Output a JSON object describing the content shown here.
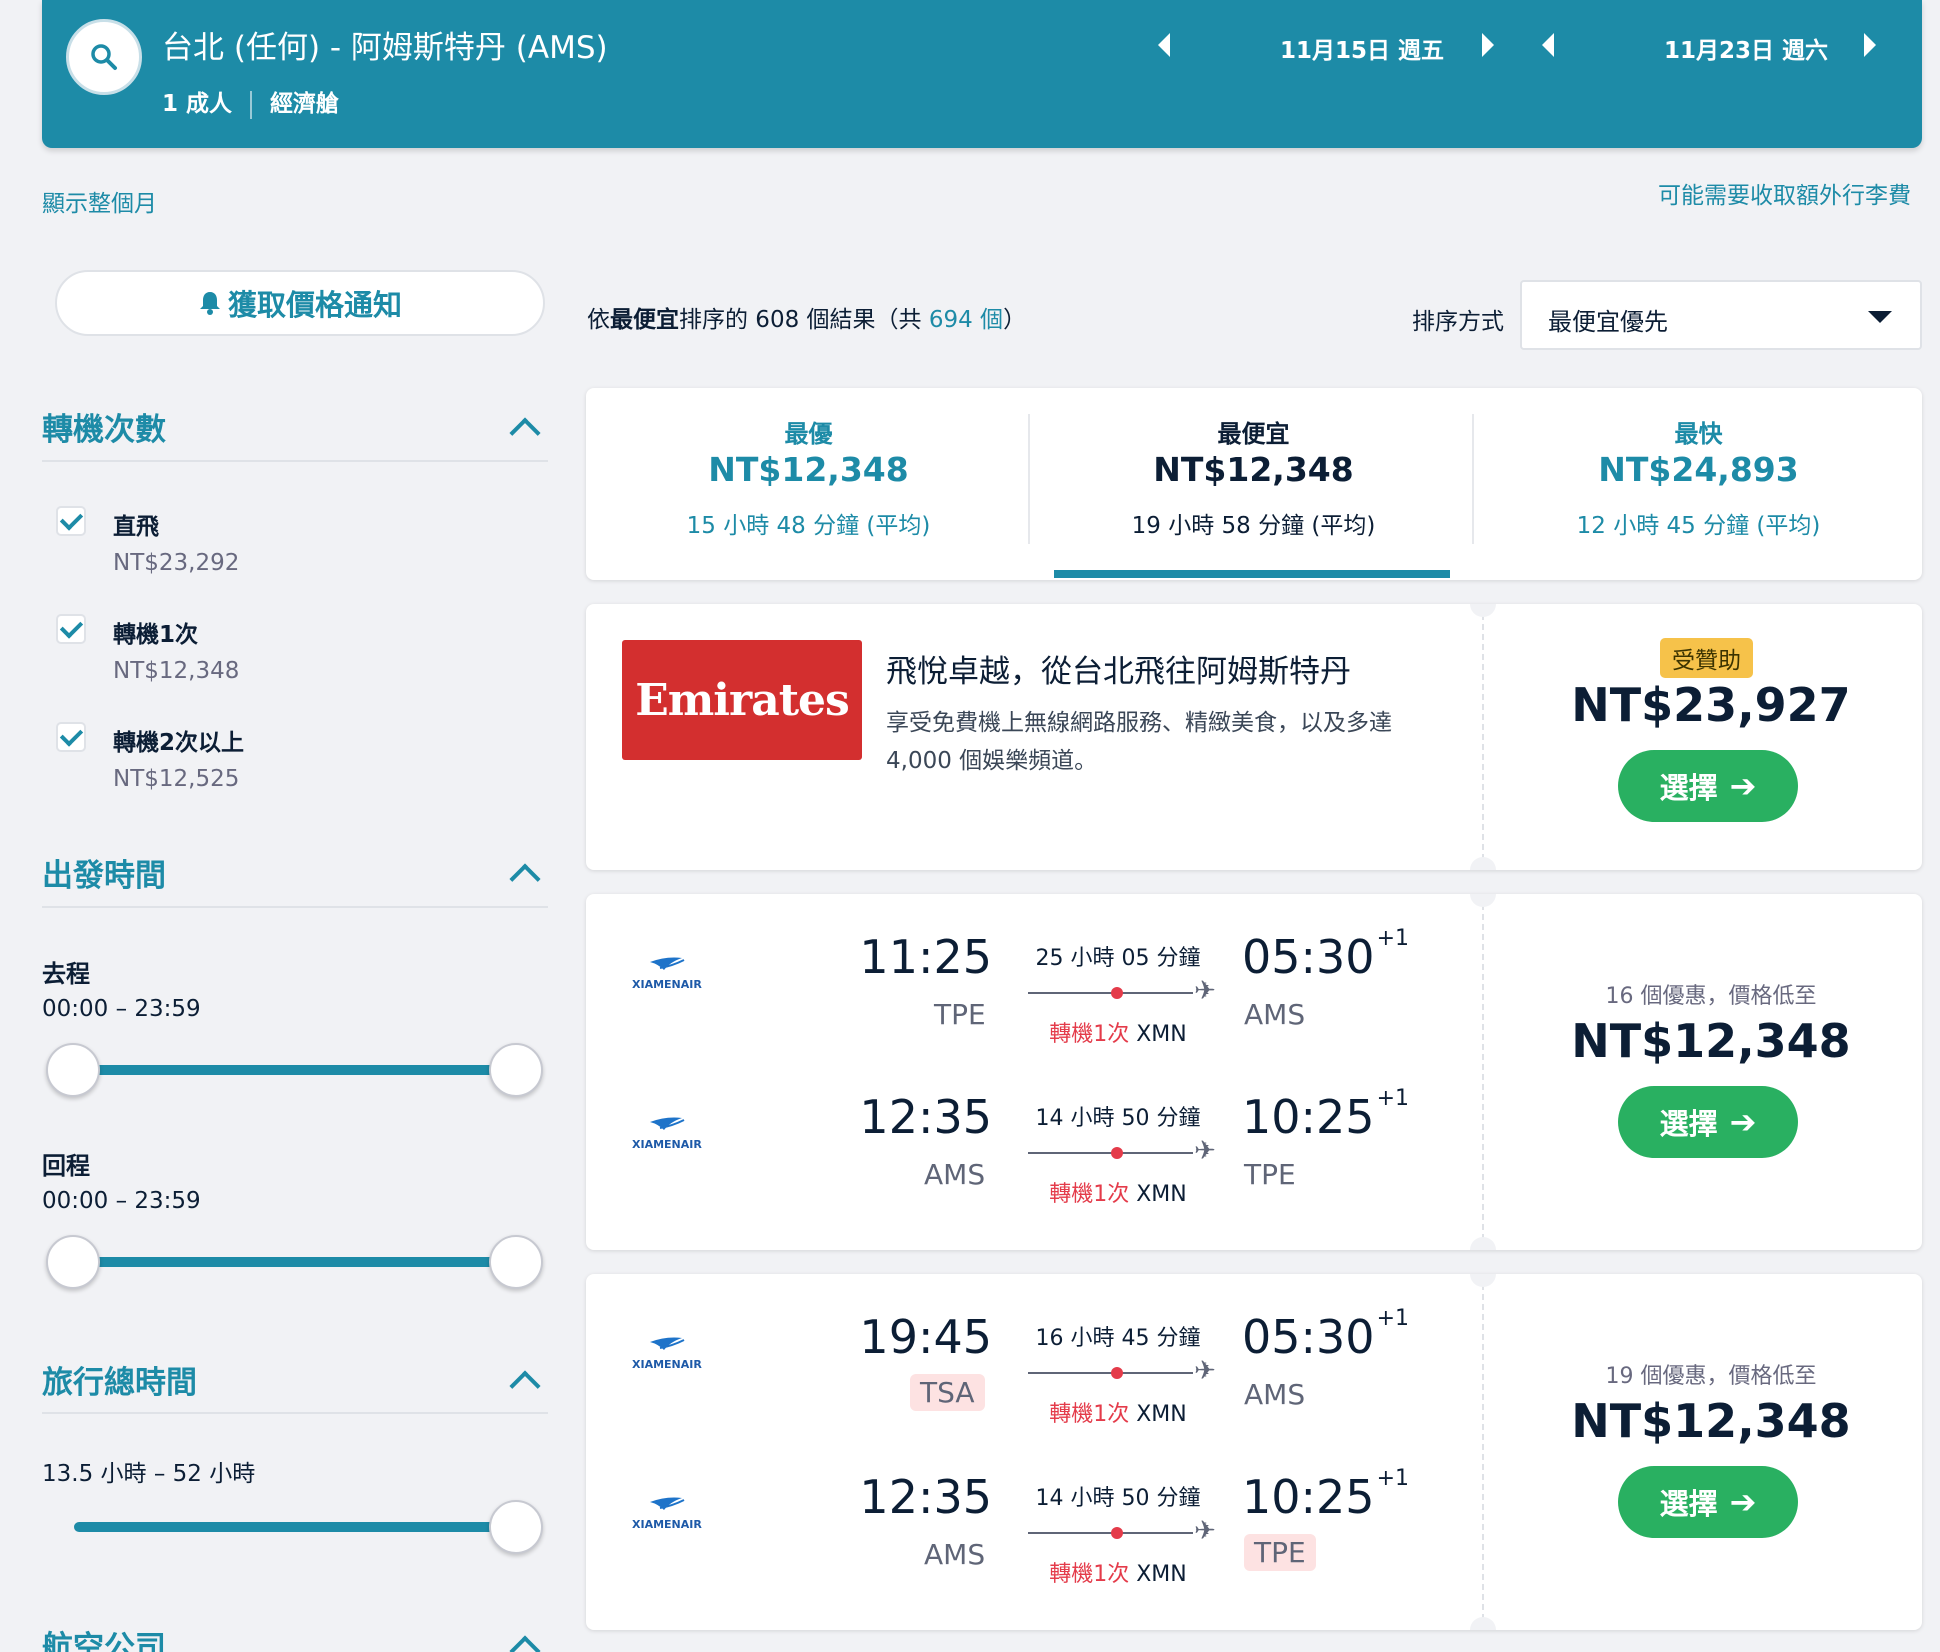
{
  "header": {
    "route": "台北 (任何) - 阿姆斯特丹 (AMS)",
    "passengers": "1 成人",
    "cabin": "經濟艙",
    "depart_date": "11月15日 週五",
    "return_date": "11月23日 週六"
  },
  "links": {
    "show_month": "顯示整個月",
    "baggage_fee": "可能需要收取額外行李費"
  },
  "sidebar": {
    "alert_button": "獲取價格通知",
    "stops": {
      "title": "轉機次數",
      "options": [
        {
          "label": "直飛",
          "price": "NT$23,292",
          "checked": true
        },
        {
          "label": "轉機1次",
          "price": "NT$12,348",
          "checked": true
        },
        {
          "label": "轉機2次以上",
          "price": "NT$12,525",
          "checked": true
        }
      ]
    },
    "depart_time": {
      "title": "出發時間",
      "outbound_label": "去程",
      "outbound_range": "00:00 – 23:59",
      "return_label": "回程",
      "return_range": "00:00 – 23:59"
    },
    "duration": {
      "title": "旅行總時間",
      "range": "13.5 小時 – 52 小時"
    },
    "airlines": {
      "title": "航空公司"
    }
  },
  "results": {
    "prefix": "依",
    "sort_bold": "最便宜",
    "middle": "排序的 608 個結果（共 ",
    "total_link": "694 個",
    "suffix": "）",
    "sort_label": "排序方式",
    "sort_value": "最便宜優先"
  },
  "tabs": [
    {
      "name": "最優",
      "price": "NT$12,348",
      "duration": "15 小時 48 分鐘 (平均)"
    },
    {
      "name": "最便宜",
      "price": "NT$12,348",
      "duration": "19 小時 58 分鐘 (平均)"
    },
    {
      "name": "最快",
      "price": "NT$24,893",
      "duration": "12 小時 45 分鐘 (平均)"
    }
  ],
  "ad": {
    "logo_text": "Emirates",
    "title": "飛悅卓越，從台北飛往阿姆斯特丹",
    "desc": "享受免費機上無線網路服務、精緻美食，以及多達 4,000 個娛樂頻道。",
    "badge": "受贊助",
    "price": "NT$23,927",
    "select": "選擇"
  },
  "flights": [
    {
      "deals": "16 個優惠，價格低至",
      "price": "NT$12,348",
      "select": "選擇",
      "legs": [
        {
          "airline": "XIAMENAIR",
          "dep_time": "11:25",
          "dep_airport": "TPE",
          "duration": "25 小時 05 分鐘",
          "stops": "轉機1次",
          "via": "XMN",
          "arr_time": "05:30",
          "arr_plus": "+1",
          "arr_airport": "AMS"
        },
        {
          "airline": "XIAMENAIR",
          "dep_time": "12:35",
          "dep_airport": "AMS",
          "duration": "14 小時 50 分鐘",
          "stops": "轉機1次",
          "via": "XMN",
          "arr_time": "10:25",
          "arr_plus": "+1",
          "arr_airport": "TPE"
        }
      ]
    },
    {
      "deals": "19 個優惠，價格低至",
      "price": "NT$12,348",
      "select": "選擇",
      "legs": [
        {
          "airline": "XIAMENAIR",
          "dep_time": "19:45",
          "dep_airport": "TSA",
          "duration": "16 小時 45 分鐘",
          "stops": "轉機1次",
          "via": "XMN",
          "arr_time": "05:30",
          "arr_plus": "+1",
          "arr_airport": "AMS"
        },
        {
          "airline": "XIAMENAIR",
          "dep_time": "12:35",
          "dep_airport": "AMS",
          "duration": "14 小時 50 分鐘",
          "stops": "轉機1次",
          "via": "XMN",
          "arr_time": "10:25",
          "arr_plus": "+1",
          "arr_airport": "TPE"
        }
      ]
    }
  ],
  "colors": {
    "accent": "#1d8ba7",
    "select_button": "#29b061",
    "stop_red": "#e43b4a",
    "emirates_red": "#d32f2f",
    "badge": "#f6c24a"
  }
}
